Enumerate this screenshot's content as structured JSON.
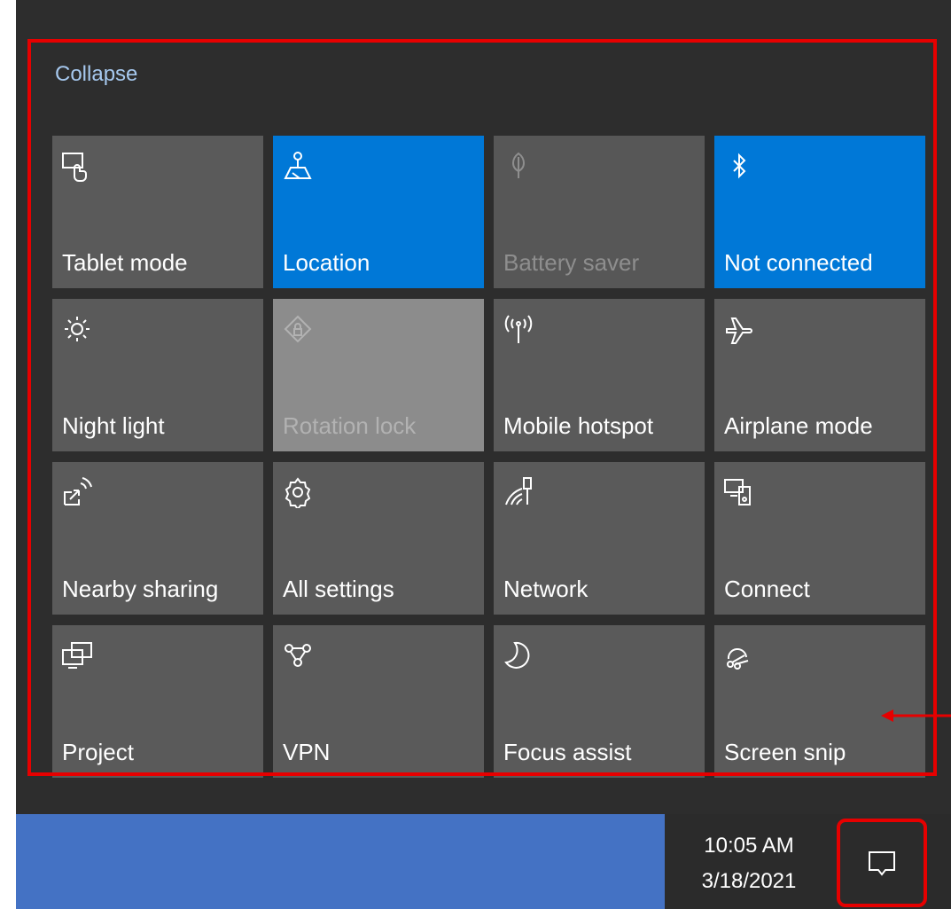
{
  "panel": {
    "collapse_label": "Collapse"
  },
  "tiles": [
    {
      "label": "Tablet mode",
      "icon": "tablet-mode-icon",
      "state": "off"
    },
    {
      "label": "Location",
      "icon": "location-icon",
      "state": "on"
    },
    {
      "label": "Battery saver",
      "icon": "battery-saver-icon",
      "state": "disabled"
    },
    {
      "label": "Not connected",
      "icon": "bluetooth-icon",
      "state": "on"
    },
    {
      "label": "Night light",
      "icon": "night-light-icon",
      "state": "off"
    },
    {
      "label": "Rotation lock",
      "icon": "rotation-lock-icon",
      "state": "disabled"
    },
    {
      "label": "Mobile hotspot",
      "icon": "mobile-hotspot-icon",
      "state": "off"
    },
    {
      "label": "Airplane mode",
      "icon": "airplane-icon",
      "state": "off"
    },
    {
      "label": "Nearby sharing",
      "icon": "nearby-sharing-icon",
      "state": "off"
    },
    {
      "label": "All settings",
      "icon": "gear-icon",
      "state": "off"
    },
    {
      "label": "Network",
      "icon": "network-icon",
      "state": "off"
    },
    {
      "label": "Connect",
      "icon": "connect-icon",
      "state": "off"
    },
    {
      "label": "Project",
      "icon": "project-icon",
      "state": "off"
    },
    {
      "label": "VPN",
      "icon": "vpn-icon",
      "state": "off"
    },
    {
      "label": "Focus assist",
      "icon": "moon-icon",
      "state": "off"
    },
    {
      "label": "Screen snip",
      "icon": "screen-snip-icon",
      "state": "off"
    }
  ],
  "taskbar": {
    "time": "10:05 AM",
    "date": "3/18/2021",
    "action_center_icon": "action-center-icon"
  },
  "colors": {
    "panel_background": "#2d2d2d",
    "tile_off": "#5a5a5a",
    "tile_on": "#0078d7",
    "highlight": "#e60000",
    "taskbar_blue": "#4472c4"
  }
}
